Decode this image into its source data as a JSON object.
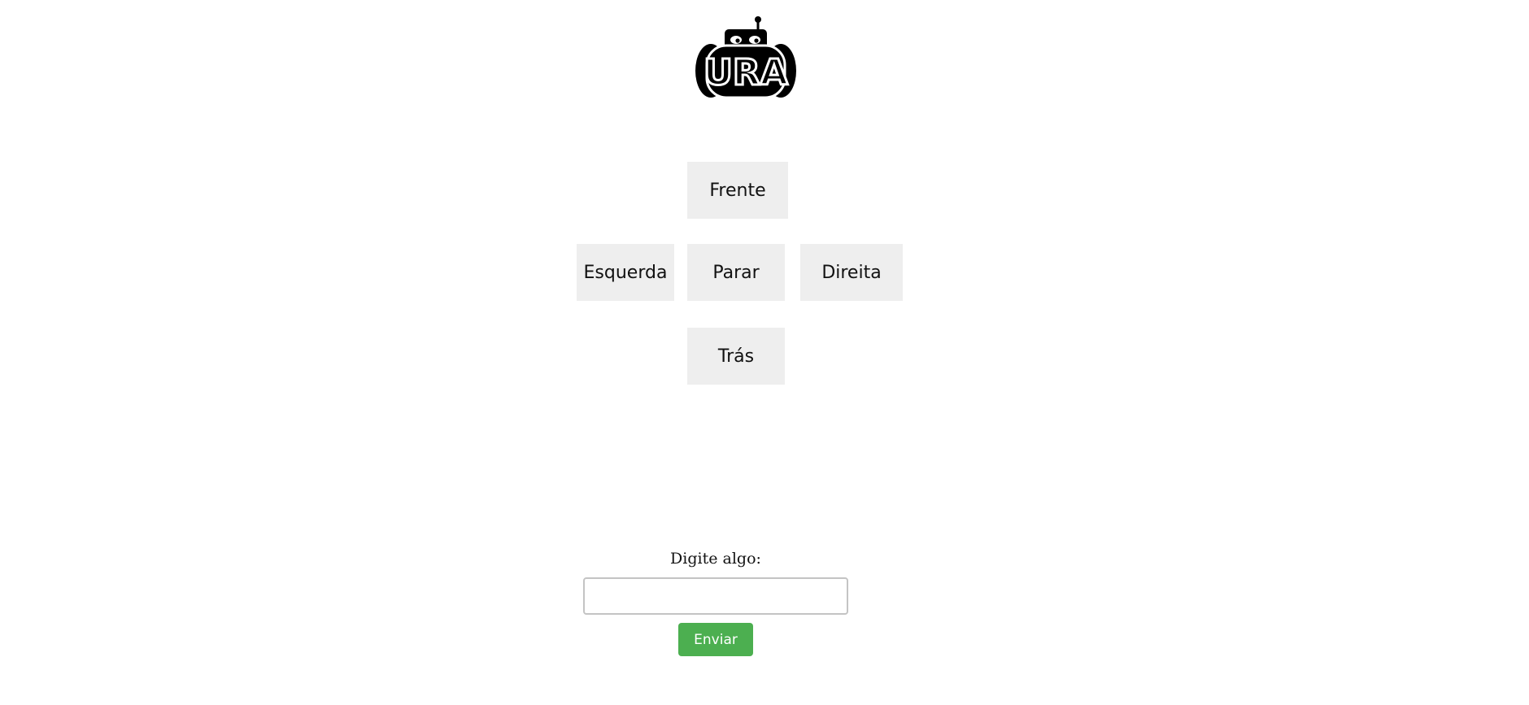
{
  "logo": {
    "text": "URA",
    "icon": "robot-logo-icon"
  },
  "controls": {
    "forward_label": "Frente",
    "left_label": "Esquerda",
    "stop_label": "Parar",
    "right_label": "Direita",
    "back_label": "Trás"
  },
  "form": {
    "label": "Digite algo:",
    "input_value": "",
    "input_placeholder": "",
    "submit_label": "Enviar"
  },
  "colors": {
    "button_bg": "#eeeeee",
    "submit_bg": "#4caf50",
    "input_border": "#c4c4c4"
  }
}
